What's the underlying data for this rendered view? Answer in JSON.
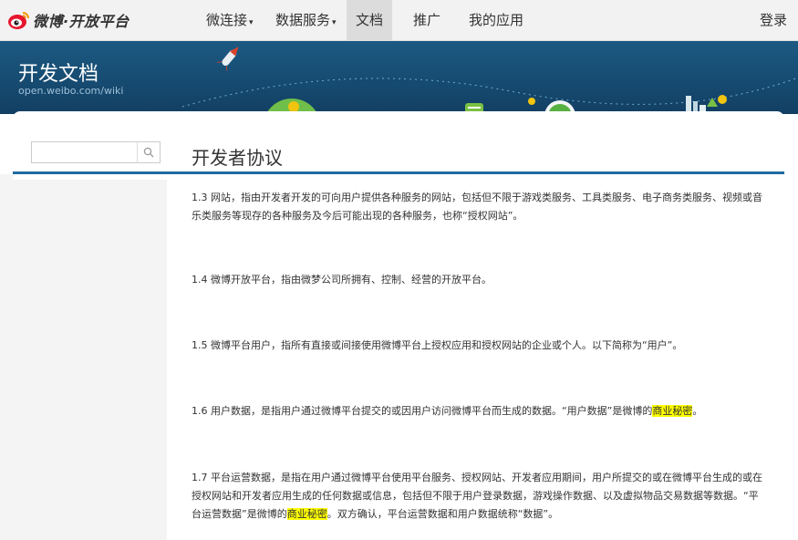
{
  "nav": {
    "brand": "微博·开放平台",
    "items": [
      {
        "label": "微连接",
        "dropdown": true
      },
      {
        "label": "数据服务",
        "dropdown": true
      },
      {
        "label": "文档",
        "dropdown": false
      },
      {
        "label": "推广",
        "dropdown": false
      },
      {
        "label": "我的应用",
        "dropdown": false
      }
    ],
    "caret": "▾",
    "login": "登录"
  },
  "banner": {
    "title": "开发文档",
    "subtitle": "open.weibo.com/wiki"
  },
  "search": {
    "placeholder": "",
    "value": ""
  },
  "page": {
    "title": "开发者协议"
  },
  "article": {
    "p1": "1.3 网站，指由开发者开发的可向用户提供各种服务的网站，包括但不限于游戏类服务、工具类服务、电子商务类服务、视频或音乐类服务等现存的各种服务及今后可能出现的各种服务，也称“授权网站”。",
    "p2": "1.4 微博开放平台，指由微梦公司所拥有、控制、经营的开放平台。",
    "p3": "1.5 微博平台用户，指所有直接或间接使用微博平台上授权应用和授权网站的企业或个人。以下简称为“用户”。",
    "p4_before": "1.6 用户数据，是指用户通过微博平台提交的或因用户访问微博平台而生成的数据。“用户数据”是微博的",
    "p4_highlight": "商业秘密",
    "p4_after": "。",
    "p5_before": "1.7 平台运营数据，是指在用户通过微博平台使用平台服务、授权网站、开发者应用期间，用户所提交的或在微博平台生成的或在授权网站和开发者应用生成的任何数据或信息，包括但不限于用户登录数据，游戏操作数据、以及虚拟物品交易数据等数据。“平台运营数据”是微博的",
    "p5_highlight": "商业秘密",
    "p5_after": "。双方确认，平台运营数据和用户数据统称“数据”。"
  },
  "colors": {
    "banner": "#1c5a82",
    "accent": "#1f6aa0",
    "highlight": "#ffff00"
  }
}
